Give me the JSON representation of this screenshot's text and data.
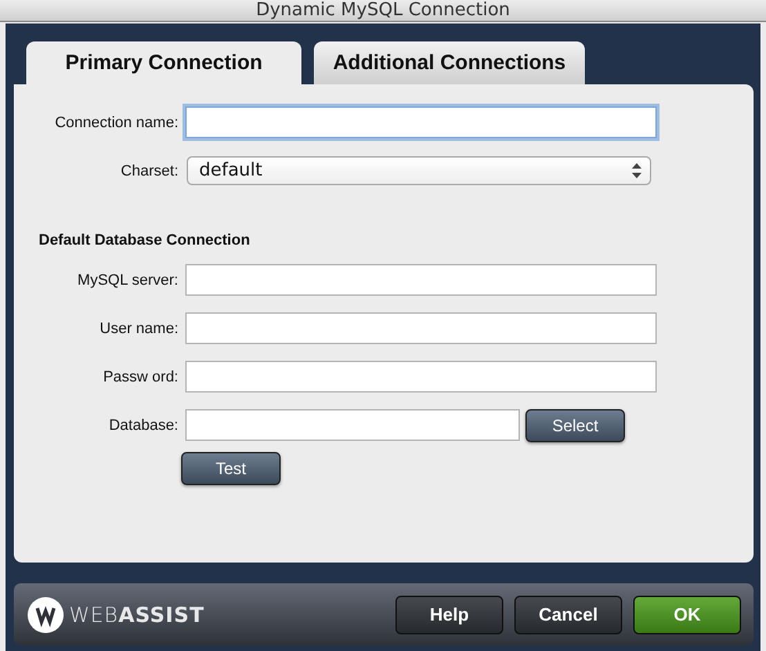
{
  "window": {
    "title": "Dynamic MySQL Connection"
  },
  "tabs": [
    {
      "label": "Primary Connection",
      "selected": true
    },
    {
      "label": "Additional Connections",
      "selected": false
    }
  ],
  "connection_fields": [
    {
      "kind": "text",
      "label": "Connection name:",
      "focused": true
    },
    {
      "kind": "select",
      "label": "Charset:",
      "value": "default"
    }
  ],
  "section_title": "Default Database Connection",
  "database_fields": [
    {
      "label": "MySQL server:"
    },
    {
      "label": "User name:"
    },
    {
      "label": "Passw ord:"
    },
    {
      "label": "Database:",
      "button": "Select"
    }
  ],
  "test_button": "Test",
  "footer": {
    "logo": "WEB**ASSIST**",
    "buttons": [
      {
        "label": "Help",
        "kind": "normal"
      },
      {
        "label": "Cancel",
        "kind": "normal"
      },
      {
        "label": "OK",
        "kind": "primary"
      }
    ]
  }
}
